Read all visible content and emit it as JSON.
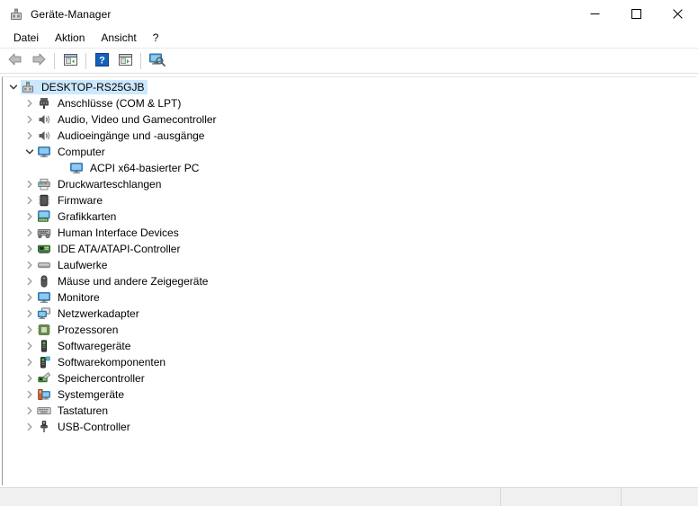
{
  "window": {
    "title": "Geräte-Manager",
    "icon": "device-manager-icon",
    "controls": {
      "minimize": "Minimieren",
      "maximize": "Maximieren",
      "close": "Schließen"
    }
  },
  "menubar": {
    "items": [
      {
        "label": "Datei"
      },
      {
        "label": "Aktion"
      },
      {
        "label": "Ansicht"
      },
      {
        "label": "?"
      }
    ]
  },
  "toolbar": {
    "buttons": [
      {
        "name": "back-button",
        "icon": "back-arrow-icon"
      },
      {
        "name": "forward-button",
        "icon": "forward-arrow-icon"
      },
      {
        "name": "properties-button",
        "icon": "properties-window-icon"
      },
      {
        "name": "help-button",
        "icon": "help-question-icon"
      },
      {
        "name": "update-driver-button",
        "icon": "play-window-icon"
      },
      {
        "name": "scan-hardware-button",
        "icon": "scan-monitor-icon"
      }
    ]
  },
  "tree": {
    "nodes": [
      {
        "label": "DESKTOP-RS25GJB",
        "level": 0,
        "expanded": true,
        "selected": true,
        "icon": "computer-device-icon"
      },
      {
        "label": "Anschlüsse (COM & LPT)",
        "level": 1,
        "expanded": false,
        "selected": false,
        "icon": "port-connector-icon"
      },
      {
        "label": "Audio, Video und Gamecontroller",
        "level": 1,
        "expanded": false,
        "selected": false,
        "icon": "speaker-icon"
      },
      {
        "label": "Audioeingänge und -ausgänge",
        "level": 1,
        "expanded": false,
        "selected": false,
        "icon": "speaker-icon"
      },
      {
        "label": "Computer",
        "level": 1,
        "expanded": true,
        "selected": false,
        "icon": "monitor-icon"
      },
      {
        "label": "ACPI x64-basierter PC",
        "level": 2,
        "expanded": null,
        "selected": false,
        "icon": "monitor-icon"
      },
      {
        "label": "Druckwarteschlangen",
        "level": 1,
        "expanded": false,
        "selected": false,
        "icon": "printer-icon"
      },
      {
        "label": "Firmware",
        "level": 1,
        "expanded": false,
        "selected": false,
        "icon": "chip-icon"
      },
      {
        "label": "Grafikkarten",
        "level": 1,
        "expanded": false,
        "selected": false,
        "icon": "display-adapter-icon"
      },
      {
        "label": "Human Interface Devices",
        "level": 1,
        "expanded": false,
        "selected": false,
        "icon": "hid-device-icon"
      },
      {
        "label": "IDE ATA/ATAPI-Controller",
        "level": 1,
        "expanded": false,
        "selected": false,
        "icon": "ide-controller-icon"
      },
      {
        "label": "Laufwerke",
        "level": 1,
        "expanded": false,
        "selected": false,
        "icon": "disk-drive-icon"
      },
      {
        "label": "Mäuse und andere Zeigegeräte",
        "level": 1,
        "expanded": false,
        "selected": false,
        "icon": "mouse-icon"
      },
      {
        "label": "Monitore",
        "level": 1,
        "expanded": false,
        "selected": false,
        "icon": "monitor-icon"
      },
      {
        "label": "Netzwerkadapter",
        "level": 1,
        "expanded": false,
        "selected": false,
        "icon": "network-adapter-icon"
      },
      {
        "label": "Prozessoren",
        "level": 1,
        "expanded": false,
        "selected": false,
        "icon": "processor-icon"
      },
      {
        "label": "Softwaregeräte",
        "level": 1,
        "expanded": false,
        "selected": false,
        "icon": "software-device-icon"
      },
      {
        "label": "Softwarekomponenten",
        "level": 1,
        "expanded": false,
        "selected": false,
        "icon": "software-component-icon"
      },
      {
        "label": "Speichercontroller",
        "level": 1,
        "expanded": false,
        "selected": false,
        "icon": "storage-controller-icon"
      },
      {
        "label": "Systemgeräte",
        "level": 1,
        "expanded": false,
        "selected": false,
        "icon": "system-device-icon"
      },
      {
        "label": "Tastaturen",
        "level": 1,
        "expanded": false,
        "selected": false,
        "icon": "keyboard-icon"
      },
      {
        "label": "USB-Controller",
        "level": 1,
        "expanded": false,
        "selected": false,
        "icon": "usb-icon"
      }
    ]
  },
  "statusbar": {
    "panes": [
      {
        "text": ""
      },
      {
        "text": ""
      },
      {
        "text": ""
      }
    ]
  },
  "colors": {
    "selection": "#cce8ff",
    "window_bg": "#ffffff",
    "statusbar_bg": "#f0f0f0",
    "border": "#9a9a9a"
  }
}
